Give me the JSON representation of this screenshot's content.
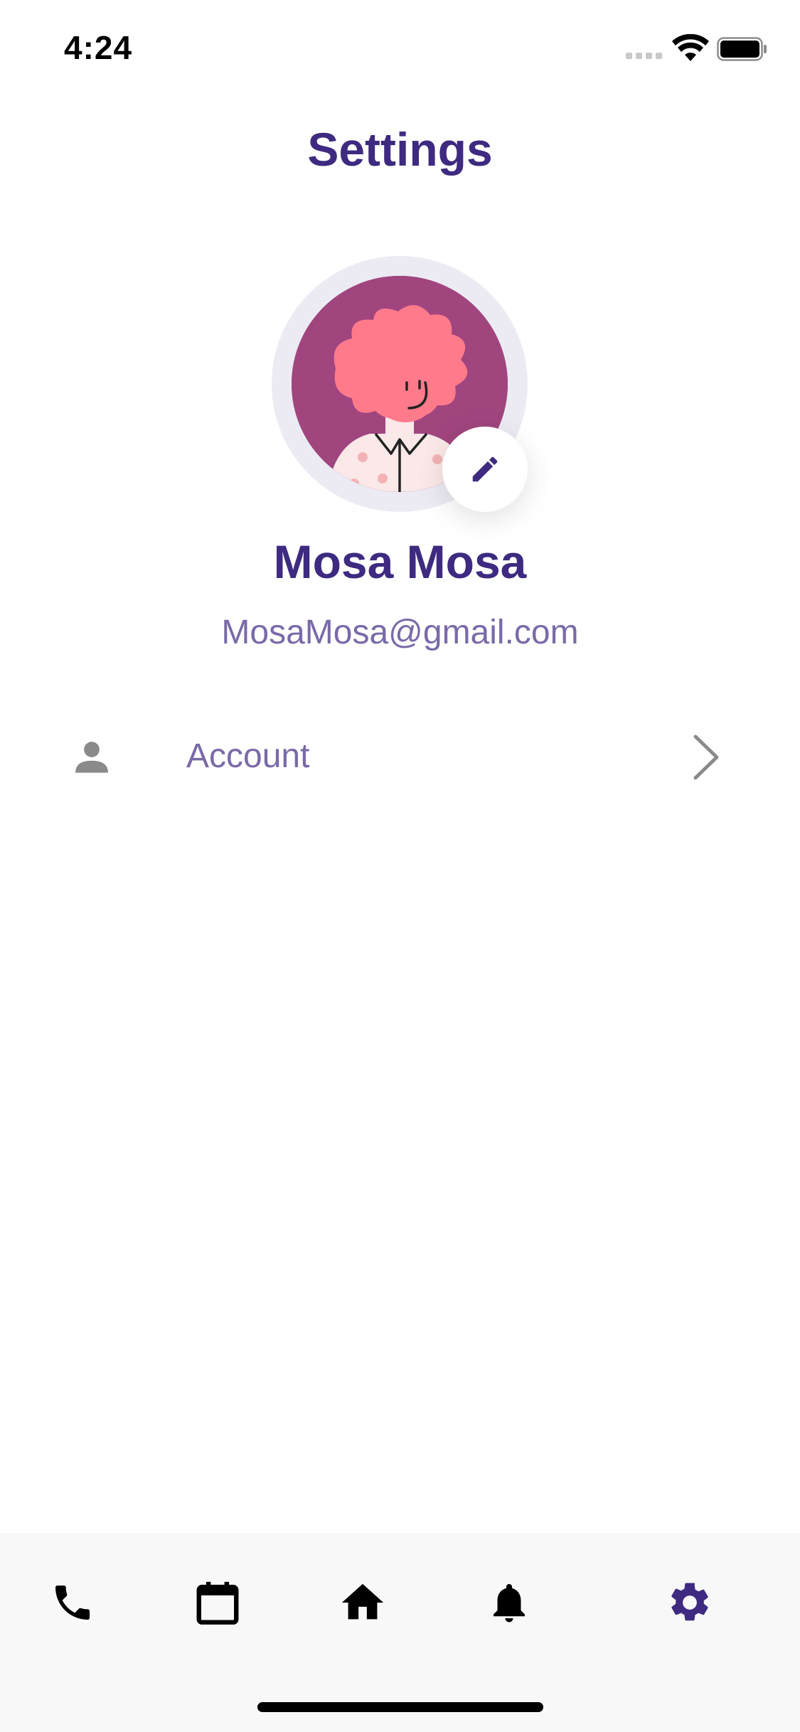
{
  "status_bar": {
    "time": "4:24"
  },
  "header": {
    "title": "Settings"
  },
  "profile": {
    "name": "Mosa Mosa",
    "email": "MosaMosa@gmail.com"
  },
  "settings_items": [
    {
      "label": "Account",
      "icon": "person-icon"
    }
  ],
  "bottom_nav": {
    "items": [
      {
        "name": "phone",
        "icon": "phone-icon",
        "active": false
      },
      {
        "name": "calendar",
        "icon": "calendar-icon",
        "active": false
      },
      {
        "name": "home",
        "icon": "home-icon",
        "active": false
      },
      {
        "name": "notifications",
        "icon": "bell-icon",
        "active": false
      },
      {
        "name": "settings",
        "icon": "gear-icon",
        "active": true
      }
    ]
  },
  "colors": {
    "primary": "#3e2a80",
    "secondary_text": "#7a6aa8",
    "avatar_bg": "#a1457f",
    "nav_bg": "#f8f8f8"
  }
}
